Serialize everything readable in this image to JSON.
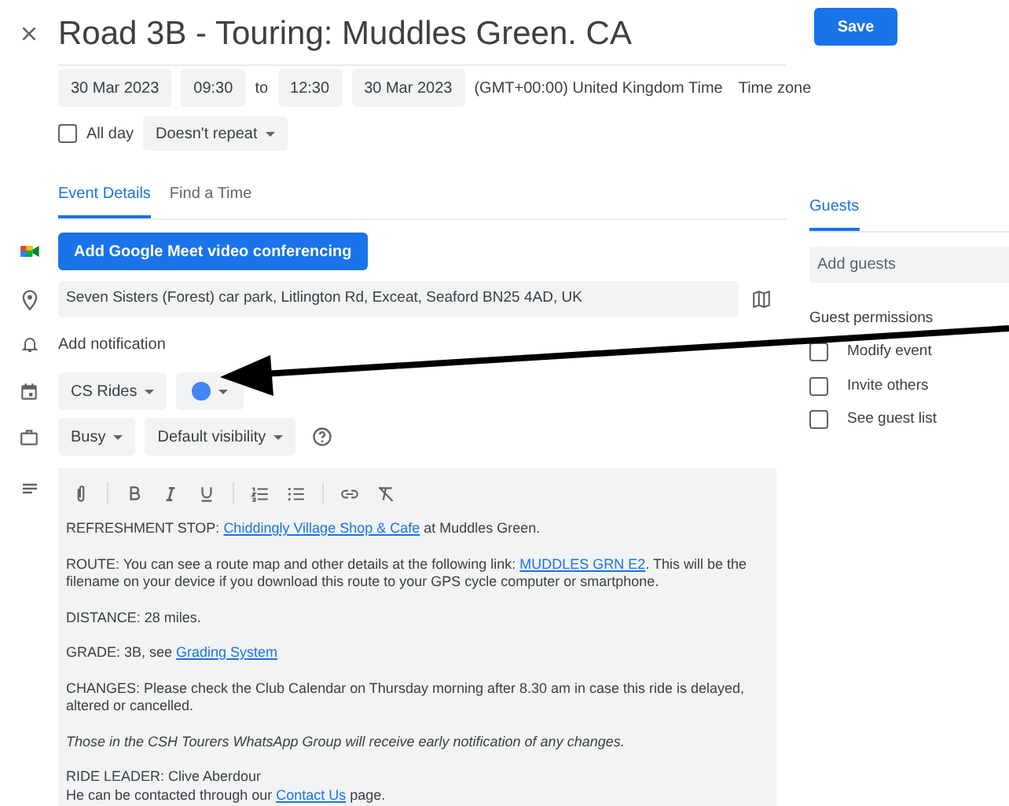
{
  "title": "Road 3B - Touring: Muddles Green. CA",
  "save_button": "Save",
  "date_time": {
    "start_date": "30 Mar 2023",
    "start_time": "09:30",
    "separator": "to",
    "end_time": "12:30",
    "end_date": "30 Mar 2023",
    "zone": "(GMT+00:00) United Kingdom Time",
    "zone_button": "Time zone"
  },
  "all_day": {
    "label": "All day",
    "checked": false
  },
  "repeat": "Doesn't repeat",
  "tabs": [
    {
      "label": "Event Details",
      "selected": true
    },
    {
      "label": "Find a Time",
      "selected": false
    }
  ],
  "meet_button": "Add Google Meet video conferencing",
  "location": "Seven Sisters (Forest) car park, Litlington Rd, Exceat, Seaford BN25 4AD, UK",
  "notification": "Add notification",
  "calendar": "CS Rides",
  "event_color": {
    "color": "#4285f4"
  },
  "availability": "Busy",
  "visibility": "Default visibility",
  "description": [
    {
      "italic": false,
      "lines": [
        [
          {
            "kind": "text",
            "text": "REFRESHMENT STOP: "
          },
          {
            "kind": "link",
            "text": "Chiddingly Village Shop & Cafe"
          },
          {
            "kind": "text",
            "text": " at Muddles Green."
          }
        ]
      ]
    },
    {
      "italic": false,
      "lines": [
        [
          {
            "kind": "text",
            "text": "ROUTE: You can see a route map and other details at the following link: "
          },
          {
            "kind": "link",
            "text": "MUDDLES GRN E2"
          },
          {
            "kind": "text",
            "text": ". This will be the filename on your device if you download this route to your GPS cycle computer or smartphone."
          }
        ]
      ]
    },
    {
      "italic": false,
      "lines": [
        [
          {
            "kind": "text",
            "text": "DISTANCE: 28 miles."
          }
        ]
      ]
    },
    {
      "italic": false,
      "lines": [
        [
          {
            "kind": "text",
            "text": "GRADE: 3B, see "
          },
          {
            "kind": "link",
            "text": "Grading System"
          }
        ]
      ]
    },
    {
      "italic": false,
      "lines": [
        [
          {
            "kind": "text",
            "text": "CHANGES: Please check the Club Calendar on Thursday morning after 8.30 am in case this ride is delayed, altered or cancelled."
          }
        ]
      ]
    },
    {
      "italic": true,
      "lines": [
        [
          {
            "kind": "text",
            "text": "Those in the CSH Tourers WhatsApp Group will receive early notification of any changes."
          }
        ]
      ]
    },
    {
      "italic": false,
      "lines": [
        [
          {
            "kind": "text",
            "text": "RIDE LEADER: Clive Aberdour"
          }
        ],
        [
          {
            "kind": "text",
            "text": "He can be contacted through our "
          },
          {
            "kind": "link",
            "text": "Contact Us"
          },
          {
            "kind": "text",
            "text": " page."
          }
        ]
      ]
    }
  ],
  "guests": {
    "tab": "Guests",
    "placeholder": "Add guests",
    "permissions_heading": "Guest permissions",
    "permissions": [
      {
        "label": "Modify event",
        "checked": false
      },
      {
        "label": "Invite others",
        "checked": false
      },
      {
        "label": "See guest list",
        "checked": false
      }
    ]
  }
}
